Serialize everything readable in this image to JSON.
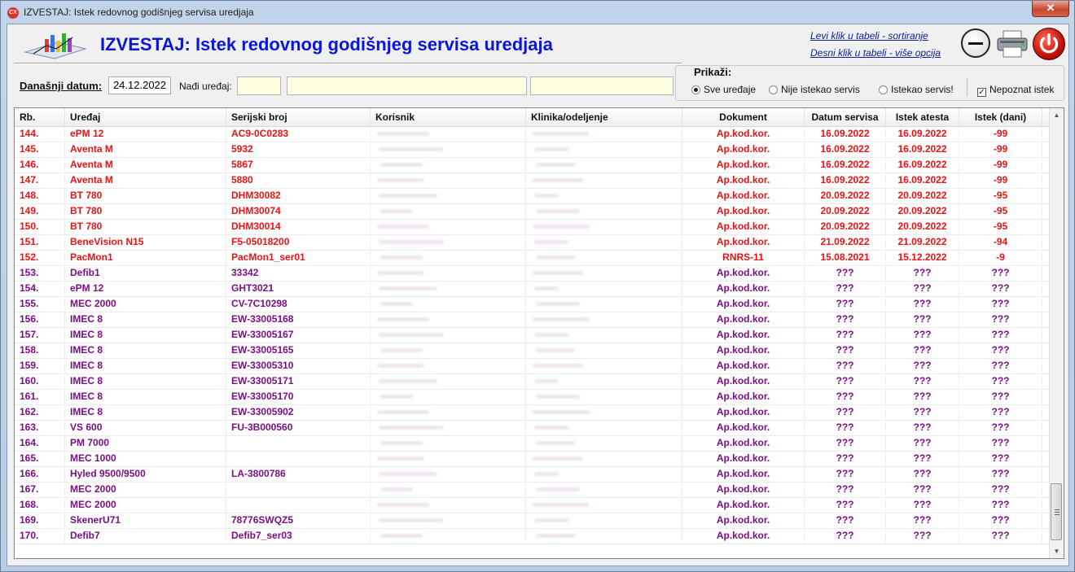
{
  "window": {
    "title": "IZVESTAJ: Istek redovnog godišnjeg servisa uredjaja",
    "icon": "app-logo-icon",
    "close": "✕"
  },
  "header": {
    "title": "IZVESTAJ: Istek redovnog godišnjeg servisa uredjaja",
    "hint_left": "Levi klik u tabeli - sortiranje",
    "hint_right": "Desni klik u tabeli - više opcija",
    "buttons": [
      "minimize-icon",
      "printer-icon",
      "power-icon"
    ]
  },
  "toolbar": {
    "date_label": "Današnji datum:",
    "date_value": "24.12.2022",
    "find_label": "Nađi uređaj:"
  },
  "filter": {
    "legend": "Prikaži:",
    "options": [
      {
        "label": "Sve uređaje",
        "selected": true
      },
      {
        "label": "Nije istekao servis",
        "selected": false
      },
      {
        "label": "Istekao servis!",
        "selected": false
      }
    ],
    "unknown_label": "Nepoznat istek",
    "unknown_checked": true
  },
  "colors": {
    "expired": "#ee1111",
    "unknown": "#7a0f86",
    "header_title": "#0a17d6"
  },
  "table": {
    "columns": [
      "Rb.",
      "Uređaj",
      "Serijski broj",
      "Korisnik",
      "Klinika/odeljenje",
      "Dokument",
      "Datum servisa",
      "Istek atesta",
      "Istek (dani)"
    ],
    "rows": [
      {
        "rb": "144.",
        "device": "ePM 12",
        "serial": "AC9-0C0283",
        "doc": "Ap.kod.kor.",
        "service": "16.09.2022",
        "expiry": "16.09.2022",
        "days": "-99",
        "status": "expired"
      },
      {
        "rb": "145.",
        "device": "Aventa M",
        "serial": "5932",
        "doc": "Ap.kod.kor.",
        "service": "16.09.2022",
        "expiry": "16.09.2022",
        "days": "-99",
        "status": "expired"
      },
      {
        "rb": "146.",
        "device": "Aventa M",
        "serial": "5867",
        "doc": "Ap.kod.kor.",
        "service": "16.09.2022",
        "expiry": "16.09.2022",
        "days": "-99",
        "status": "expired"
      },
      {
        "rb": "147.",
        "device": "Aventa M",
        "serial": "5880",
        "doc": "Ap.kod.kor.",
        "service": "16.09.2022",
        "expiry": "16.09.2022",
        "days": "-99",
        "status": "expired"
      },
      {
        "rb": "148.",
        "device": "BT 780",
        "serial": "DHM30082",
        "doc": "Ap.kod.kor.",
        "service": "20.09.2022",
        "expiry": "20.09.2022",
        "days": "-95",
        "status": "expired"
      },
      {
        "rb": "149.",
        "device": "BT 780",
        "serial": "DHM30074",
        "doc": "Ap.kod.kor.",
        "service": "20.09.2022",
        "expiry": "20.09.2022",
        "days": "-95",
        "status": "expired"
      },
      {
        "rb": "150.",
        "device": "BT 780",
        "serial": "DHM30014",
        "doc": "Ap.kod.kor.",
        "service": "20.09.2022",
        "expiry": "20.09.2022",
        "days": "-95",
        "status": "expired"
      },
      {
        "rb": "151.",
        "device": "BeneVision N15",
        "serial": "F5-05018200",
        "doc": "Ap.kod.kor.",
        "service": "21.09.2022",
        "expiry": "21.09.2022",
        "days": "-94",
        "status": "expired"
      },
      {
        "rb": "152.",
        "device": "PacMon1",
        "serial": "PacMon1_ser01",
        "doc": "RNRS-11",
        "service": "15.08.2021",
        "expiry": "15.12.2022",
        "days": "-9",
        "status": "expired"
      },
      {
        "rb": "153.",
        "device": "Defib1",
        "serial": "33342",
        "doc": "Ap.kod.kor.",
        "service": "???",
        "expiry": "???",
        "days": "???",
        "status": "unknown"
      },
      {
        "rb": "154.",
        "device": "ePM 12",
        "serial": "GHT3021",
        "doc": "Ap.kod.kor.",
        "service": "???",
        "expiry": "???",
        "days": "???",
        "status": "unknown"
      },
      {
        "rb": "155.",
        "device": "MEC 2000",
        "serial": "CV-7C10298",
        "doc": "Ap.kod.kor.",
        "service": "???",
        "expiry": "???",
        "days": "???",
        "status": "unknown"
      },
      {
        "rb": "156.",
        "device": "IMEC 8",
        "serial": "EW-33005168",
        "doc": "Ap.kod.kor.",
        "service": "???",
        "expiry": "???",
        "days": "???",
        "status": "unknown"
      },
      {
        "rb": "157.",
        "device": "IMEC 8",
        "serial": "EW-33005167",
        "doc": "Ap.kod.kor.",
        "service": "???",
        "expiry": "???",
        "days": "???",
        "status": "unknown"
      },
      {
        "rb": "158.",
        "device": "IMEC 8",
        "serial": "EW-33005165",
        "doc": "Ap.kod.kor.",
        "service": "???",
        "expiry": "???",
        "days": "???",
        "status": "unknown"
      },
      {
        "rb": "159.",
        "device": "IMEC 8",
        "serial": "EW-33005310",
        "doc": "Ap.kod.kor.",
        "service": "???",
        "expiry": "???",
        "days": "???",
        "status": "unknown"
      },
      {
        "rb": "160.",
        "device": "IMEC 8",
        "serial": "EW-33005171",
        "doc": "Ap.kod.kor.",
        "service": "???",
        "expiry": "???",
        "days": "???",
        "status": "unknown"
      },
      {
        "rb": "161.",
        "device": "IMEC 8",
        "serial": "EW-33005170",
        "doc": "Ap.kod.kor.",
        "service": "???",
        "expiry": "???",
        "days": "???",
        "status": "unknown"
      },
      {
        "rb": "162.",
        "device": "IMEC 8",
        "serial": "EW-33005902",
        "doc": "Ap.kod.kor.",
        "service": "???",
        "expiry": "???",
        "days": "???",
        "status": "unknown"
      },
      {
        "rb": "163.",
        "device": "VS 600",
        "serial": "FU-3B000560",
        "doc": "Ap.kod.kor.",
        "service": "???",
        "expiry": "???",
        "days": "???",
        "status": "unknown"
      },
      {
        "rb": "164.",
        "device": "PM 7000",
        "serial": "",
        "doc": "Ap.kod.kor.",
        "service": "???",
        "expiry": "???",
        "days": "???",
        "status": "unknown"
      },
      {
        "rb": "165.",
        "device": "MEC 1000",
        "serial": "",
        "doc": "Ap.kod.kor.",
        "service": "???",
        "expiry": "???",
        "days": "???",
        "status": "unknown"
      },
      {
        "rb": "166.",
        "device": "Hyled 9500/9500",
        "serial": "LA-3800786",
        "doc": "Ap.kod.kor.",
        "service": "???",
        "expiry": "???",
        "days": "???",
        "status": "unknown"
      },
      {
        "rb": "167.",
        "device": "MEC 2000",
        "serial": "",
        "doc": "Ap.kod.kor.",
        "service": "???",
        "expiry": "???",
        "days": "???",
        "status": "unknown"
      },
      {
        "rb": "168.",
        "device": "MEC 2000",
        "serial": "",
        "doc": "Ap.kod.kor.",
        "service": "???",
        "expiry": "???",
        "days": "???",
        "status": "unknown"
      },
      {
        "rb": "169.",
        "device": "SkenerU71",
        "serial": "78776SWQZ5",
        "doc": "Ap.kod.kor.",
        "service": "???",
        "expiry": "???",
        "days": "???",
        "status": "unknown"
      },
      {
        "rb": "170.",
        "device": "Defib7",
        "serial": "Defib7_ser03",
        "doc": "Ap.kod.kor.",
        "service": "???",
        "expiry": "???",
        "days": "???",
        "status": "unknown"
      }
    ]
  },
  "scrollbar": {
    "up": "▲",
    "down": "▼"
  }
}
